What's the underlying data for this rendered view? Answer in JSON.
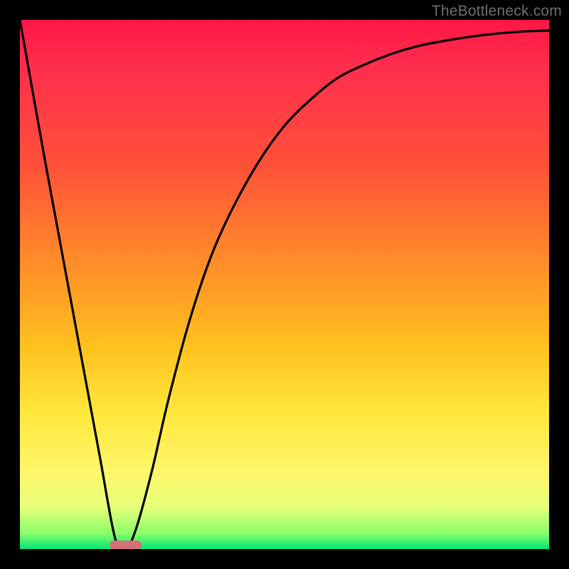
{
  "watermark": {
    "text": "TheBottleneck.com"
  },
  "chart_data": {
    "type": "line",
    "title": "",
    "xlabel": "",
    "ylabel": "",
    "xlim": [
      0,
      100
    ],
    "ylim": [
      0,
      100
    ],
    "grid": false,
    "legend": false,
    "background_gradient": {
      "direction": "vertical",
      "stops": [
        {
          "pos": 0.0,
          "color": "#ff1744"
        },
        {
          "pos": 0.28,
          "color": "#ff5238"
        },
        {
          "pos": 0.45,
          "color": "#ff8a2a"
        },
        {
          "pos": 0.62,
          "color": "#ffc21e"
        },
        {
          "pos": 0.85,
          "color": "#fff56a"
        },
        {
          "pos": 0.97,
          "color": "#8bff6a"
        },
        {
          "pos": 1.0,
          "color": "#00e676"
        }
      ]
    },
    "series": [
      {
        "name": "bottleneck-curve",
        "x": [
          0,
          5,
          10,
          15,
          18,
          20,
          22,
          25,
          28,
          32,
          36,
          40,
          45,
          50,
          55,
          60,
          65,
          70,
          75,
          80,
          85,
          90,
          95,
          100
        ],
        "y": [
          100,
          72,
          45,
          18,
          2,
          0,
          4,
          15,
          28,
          43,
          55,
          64,
          73,
          80,
          85,
          89,
          91.5,
          93.5,
          95,
          96,
          96.8,
          97.4,
          97.8,
          98
        ]
      }
    ],
    "marker": {
      "name": "optimal-range",
      "x_start": 17,
      "x_end": 23,
      "y": 0,
      "color": "#d67078"
    },
    "frame_color": "#000000"
  }
}
